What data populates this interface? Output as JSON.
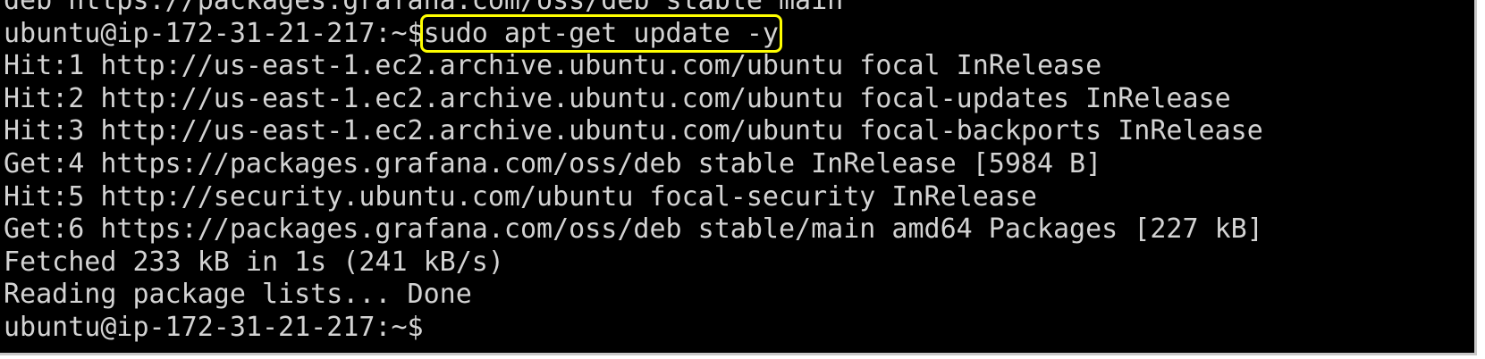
{
  "terminal": {
    "lines": [
      "deb https://packages.grafana.com/oss/deb stable main",
      "",
      "Hit:1 http://us-east-1.ec2.archive.ubuntu.com/ubuntu focal InRelease",
      "Hit:2 http://us-east-1.ec2.archive.ubuntu.com/ubuntu focal-updates InRelease",
      "Hit:3 http://us-east-1.ec2.archive.ubuntu.com/ubuntu focal-backports InRelease",
      "Get:4 https://packages.grafana.com/oss/deb stable InRelease [5984 B]",
      "Hit:5 http://security.ubuntu.com/ubuntu focal-security InRelease",
      "Get:6 https://packages.grafana.com/oss/deb stable/main amd64 Packages [227 kB]",
      "Fetched 233 kB in 1s (241 kB/s)",
      "Reading package lists... Done",
      ""
    ],
    "prompt": "ubuntu@ip-172-31-21-217:~$",
    "command": "sudo apt-get update -y",
    "highlight_color": "#ffff00"
  }
}
